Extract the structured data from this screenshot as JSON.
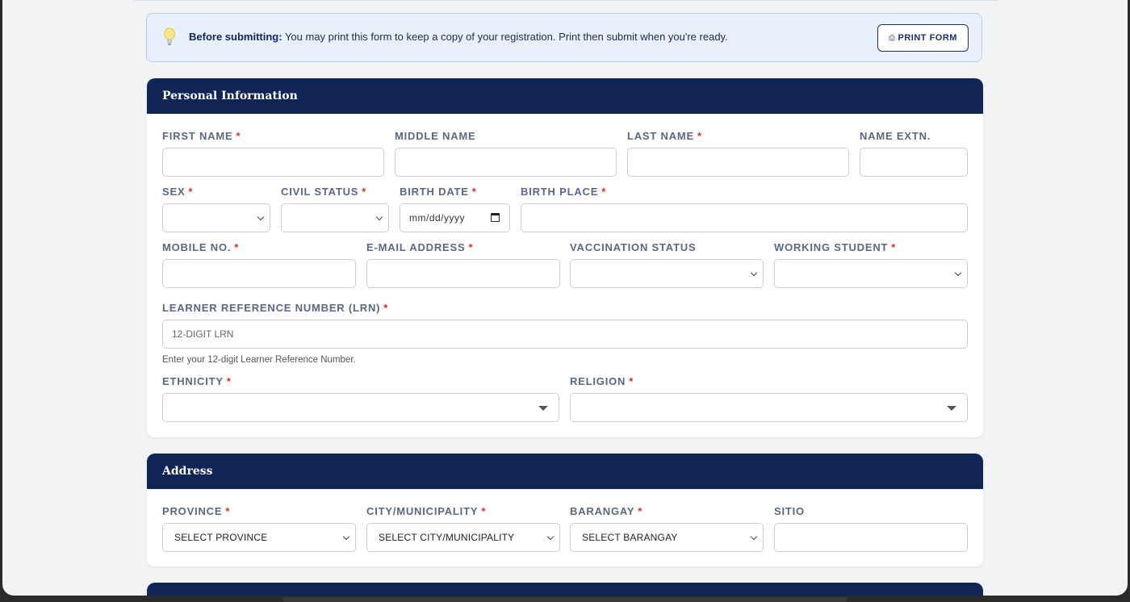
{
  "notice": {
    "icon": "lightbulb-icon",
    "bold": "Before submitting:",
    "text": " You may print this form to keep a copy of your registration. Print then submit when you're ready.",
    "print_label": "PRINT FORM"
  },
  "personal": {
    "title": "Personal Information",
    "first_name": "FIRST NAME",
    "middle_name": "MIDDLE NAME",
    "last_name": "LAST NAME",
    "name_extn": "NAME EXTN.",
    "sex": "SEX",
    "civil_status": "CIVIL STATUS",
    "birth_date": "BIRTH DATE",
    "birth_date_value": "mm/dd/yyyy",
    "birth_place": "BIRTH PLACE",
    "mobile": "MOBILE NO.",
    "email": "E-MAIL ADDRESS",
    "vaccination": "VACCINATION STATUS",
    "working_student": "WORKING STUDENT",
    "lrn": "LEARNER REFERENCE NUMBER (LRN)",
    "lrn_placeholder": "12-DIGIT LRN",
    "lrn_hint": "Enter your 12-digit Learner Reference Number.",
    "ethnicity": "ETHNICITY",
    "religion": "RELIGION",
    "required_mark": "*"
  },
  "address": {
    "title": "Address",
    "province": "PROVINCE",
    "province_value": "SELECT PROVINCE",
    "city": "CITY/MUNICIPALITY",
    "city_value": "SELECT CITY/MUNICIPALITY",
    "barangay": "BARANGAY",
    "barangay_value": "SELECT BARANGAY",
    "sitio": "SITIO"
  },
  "colors": {
    "header": "#112456",
    "required": "#d03030",
    "notice_bg": "#e8f0fc"
  }
}
